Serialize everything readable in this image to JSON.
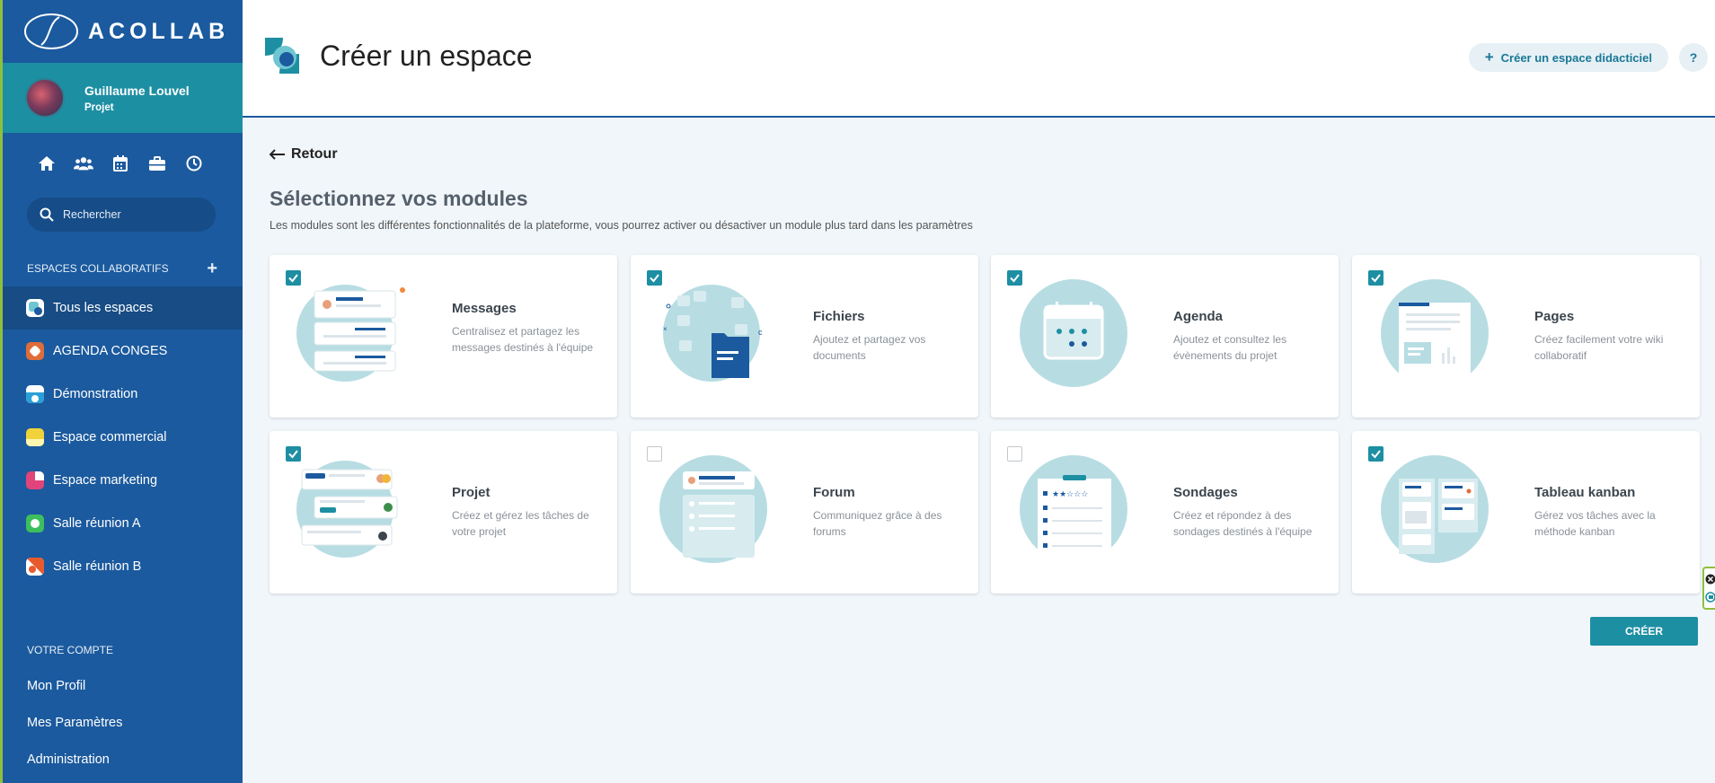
{
  "brand": {
    "name": "ACOLLAB"
  },
  "user": {
    "name": "Guillaume Louvel",
    "role": "Projet"
  },
  "nav_icons": [
    "home-icon",
    "users-icon",
    "calendar-icon",
    "briefcase-icon",
    "clock-icon"
  ],
  "search": {
    "placeholder": "Rechercher"
  },
  "spaces_section": {
    "title": "ESPACES COLLABORATIFS",
    "items": [
      {
        "label": "Tous les espaces",
        "color": "#6fc6d2"
      },
      {
        "label": "AGENDA CONGES",
        "color": "#e06c3a"
      },
      {
        "label": "Démonstration",
        "color": "#2aa0d8"
      },
      {
        "label": "Espace commercial",
        "color": "#f0d23a"
      },
      {
        "label": "Espace marketing",
        "color": "#e0447a"
      },
      {
        "label": "Salle réunion A",
        "color": "#3dbf5c"
      },
      {
        "label": "Salle réunion B",
        "color": "#e85a2e"
      }
    ]
  },
  "account_section": {
    "title": "VOTRE COMPTE",
    "links": [
      "Mon Profil",
      "Mes Paramètres",
      "Administration"
    ]
  },
  "header": {
    "title": "Créer un espace",
    "tutorial_button": "Créer un espace didacticiel",
    "help_button": "?"
  },
  "main": {
    "back_label": "Retour",
    "section_title": "Sélectionnez vos modules",
    "section_desc": "Les modules sont les différentes fonctionnalités de la plateforme, vous pourrez activer ou désactiver un module plus tard dans les paramètres",
    "modules": [
      {
        "name": "Messages",
        "desc": "Centralisez et partagez les messages destinés à l'équipe",
        "checked": true
      },
      {
        "name": "Fichiers",
        "desc": "Ajoutez et partagez vos documents",
        "checked": true
      },
      {
        "name": "Agenda",
        "desc": "Ajoutez et consultez les évènements du projet",
        "checked": true
      },
      {
        "name": "Pages",
        "desc": "Créez facilement votre wiki collaboratif",
        "checked": true
      },
      {
        "name": "Projet",
        "desc": "Créez et gérez les tâches de votre projet",
        "checked": true
      },
      {
        "name": "Forum",
        "desc": "Communiquez grâce à des forums",
        "checked": false
      },
      {
        "name": "Sondages",
        "desc": "Créez et répondez à des sondages destinés à l'équipe",
        "checked": false
      },
      {
        "name": "Tableau kanban",
        "desc": "Gérez vos tâches avec la méthode kanban",
        "checked": true
      }
    ],
    "create_button": "CRÉER"
  }
}
